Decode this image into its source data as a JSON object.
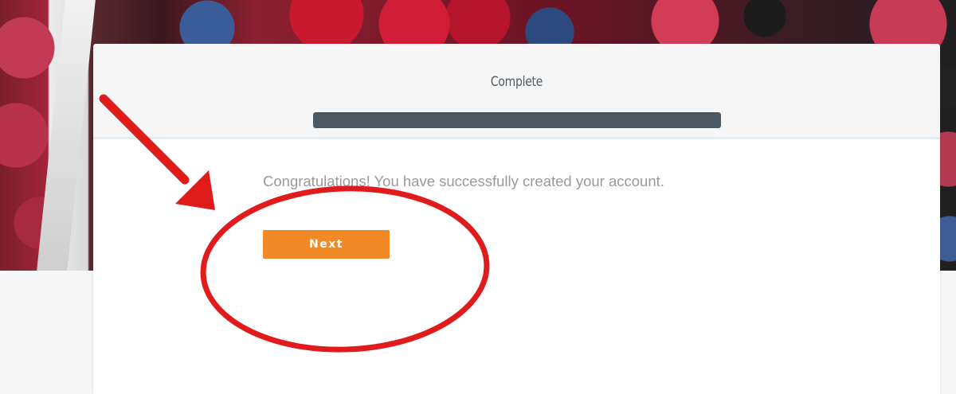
{
  "wizard": {
    "step_title": "Complete",
    "progress_percent": 100,
    "message": "Congratulations! You have successfully created your account.",
    "next_label": "Next"
  },
  "colors": {
    "accent_button": "#f18a26",
    "progress_fill": "#4b5861",
    "annotation_red": "#e01b1b"
  },
  "annotation": {
    "arrow_icon": "red-arrow-icon",
    "circle_icon": "red-circle-highlight-icon"
  }
}
